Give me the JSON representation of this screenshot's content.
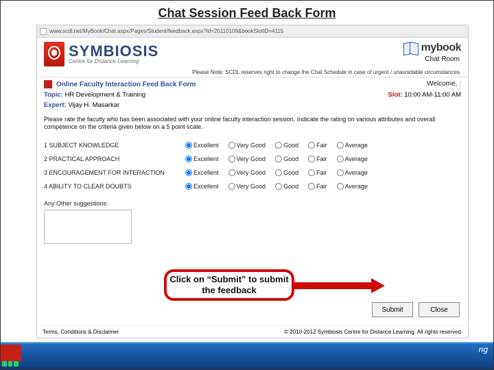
{
  "slide_title": "Chat Session Feed Back Form",
  "address_bar": "www.scdl.net/MyBook/Chat.aspx/Pages/Student/feedback.aspx?id=20110109&bookSlotID=4115",
  "brand": {
    "main": "SYMBIOSIS",
    "sub": "Centre for Distance Learning"
  },
  "mybook": "mybook",
  "chat_room": "Chat Room",
  "note": "Please Note: SCDL reserves right to change the Chat Schedule in case of urgent / unavoidable circumstances.",
  "form_title": "Online Faculty Interaction Feed Back Form",
  "welcome": "Welcome, :",
  "topic_label": "Topic:",
  "topic_value": "HR Development & Training",
  "expert_label": "Expert:",
  "expert_value": "Vijay H. Masarkar",
  "slot_label": "Slot:",
  "slot_value": "10:00 AM-11:00 AM",
  "instructions": "Please rate the faculty who has been associated with your online faculty interaction session. Indicate the rating on various attributes and overall competence on the criteria given below on a 5 point scale.",
  "criteria": [
    "1 SUBJECT KNOWLEDGE",
    "2 PRACTICAL APPROACH",
    "3 ENCOURAGEMENT FOR INTERACTION",
    "4 ABILITY TO CLEAR DOUBTS"
  ],
  "rating_options": [
    "Excellent",
    "Very Good",
    "Good",
    "Fair",
    "Average"
  ],
  "suggestions_label": "Any Other suggestions:",
  "submit": "Submit",
  "close": "Close",
  "terms": "Terms, Conditions & Disclaimer",
  "copyright": "© 2010-2012 Symbiosis Centre for Distance Learning. All rights reserved.",
  "callout": "Click on “Submit” to submit the feedback",
  "ng": "ng"
}
